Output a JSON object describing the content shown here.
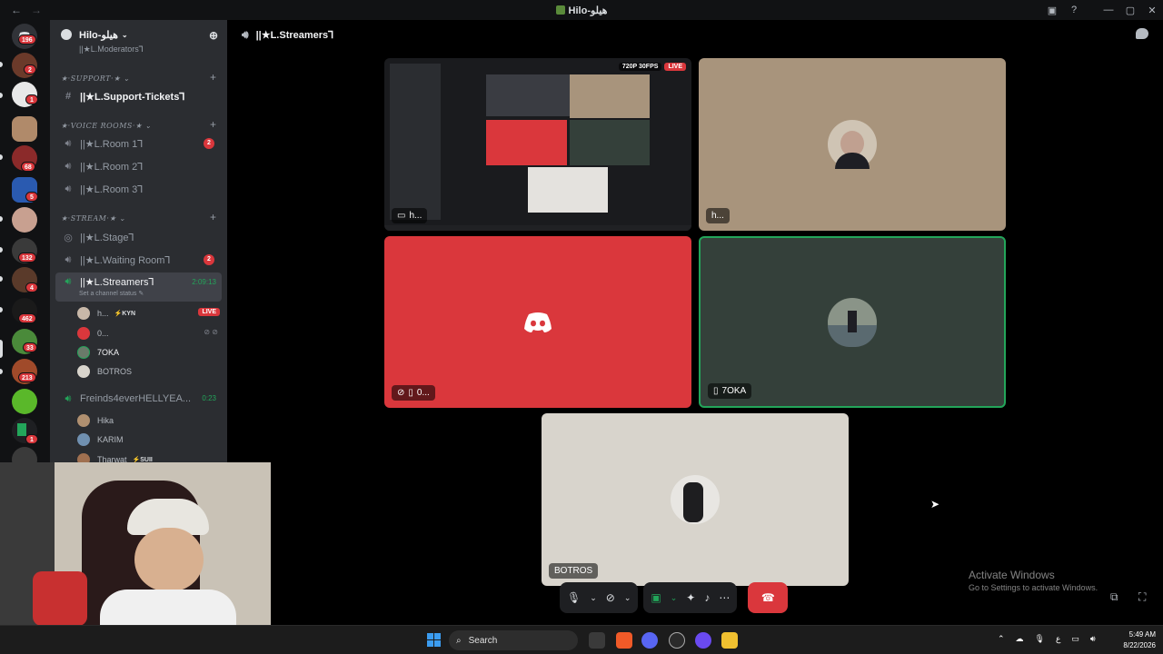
{
  "window": {
    "title": "Hilo-هيلو"
  },
  "rail": {
    "badges": [
      "196",
      "2",
      "1",
      "68",
      "5",
      "132",
      "4",
      "462",
      "33",
      "213",
      "1"
    ]
  },
  "sidebar": {
    "guild_name": "Hilo-هيلو",
    "cut_channel": "||★L.Moderators⅂",
    "categories": {
      "support": "★·SUPPORT·★",
      "voice": "★·VOICE ROOMS·★",
      "stream": "★·STREAM·★"
    },
    "channels": {
      "support_tickets": "||★L.Support-Tickets⅂",
      "room1": "||★L.Room 1⅂",
      "room1_count": "2",
      "room2": "||★L.Room 2⅂",
      "room3": "||★L.Room 3⅂",
      "stage": "||★L.Stage⅂",
      "waiting": "||★L.Waiting Room⅂",
      "waiting_count": "2",
      "streamers": "||★L.Streamers⅂",
      "streamers_timer": "2:09:13",
      "streamers_status": "Set a channel status",
      "friends": "Freinds4everHELLYEA...",
      "friends_timer": "0:23"
    },
    "voice_users": {
      "u1_name": "h...",
      "u1_tag": "⚡KYN",
      "u1_live": "LIVE",
      "u2_name": "0...",
      "u3_name": "7OKA",
      "u4_name": "BOTROS",
      "f1_name": "Hika",
      "f2_name": "KARIM",
      "f3_name": "Tharwat",
      "f3_tag": "⚡SUII"
    }
  },
  "header": {
    "channel_name": "||★L.Streamers⅂"
  },
  "tiles": {
    "stream": {
      "label": "h...",
      "quality": "720P 30FPS",
      "live": "LIVE"
    },
    "camera_h": {
      "label": "h..."
    },
    "discord_user": {
      "label": "0..."
    },
    "toka": {
      "label": "7OKA"
    },
    "botros": {
      "label": "BOTROS"
    }
  },
  "watermark": {
    "line1": "Activate Windows",
    "line2": "Go to Settings to activate Windows."
  },
  "taskbar": {
    "search": "Search",
    "time": "5:49 AM",
    "date": "8/22/2026",
    "lang": "ع"
  },
  "colors": {
    "discord_red": "#da373c",
    "speaking_green": "#23a55a",
    "sidebar_bg": "#2b2d31",
    "rail_bg": "#111214"
  }
}
